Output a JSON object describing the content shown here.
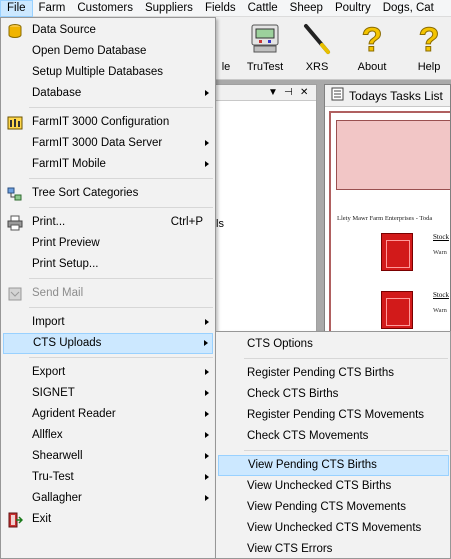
{
  "menubar": {
    "items": [
      "File",
      "Farm",
      "Customers",
      "Suppliers",
      "Fields",
      "Cattle",
      "Sheep",
      "Poultry",
      "Dogs, Cat"
    ]
  },
  "toolbar": {
    "buttons": [
      {
        "label": "le",
        "icon": "menu-icon"
      },
      {
        "label": "TruTest",
        "icon": "trutest-scale-icon"
      },
      {
        "label": "XRS",
        "icon": "xrs-wand-icon"
      },
      {
        "label": "About",
        "icon": "question-mark-icon"
      },
      {
        "label": "Help",
        "icon": "question-mark-icon"
      }
    ]
  },
  "left_panel": {
    "controls": [
      "▼",
      "⊣",
      "✕"
    ],
    "partial_text": "ls"
  },
  "tasks_window": {
    "title": "Todays Tasks List",
    "farm_line": "Llety Mawr Farm Enterprises - Toda",
    "items": [
      {
        "link": "Stock",
        "sub": "Warn"
      },
      {
        "link": "Stock",
        "sub": "Warn"
      }
    ]
  },
  "file_menu": {
    "items": [
      {
        "label": "Data Source",
        "icon": "database-icon"
      },
      {
        "label": "Open Demo Database"
      },
      {
        "label": "Setup Multiple Databases"
      },
      {
        "label": "Database",
        "submenu": true
      },
      {
        "label": "FarmIT 3000 Configuration",
        "icon": "configuration-icon"
      },
      {
        "label": "FarmIT 3000 Data Server",
        "submenu": true
      },
      {
        "label": "FarmIT Mobile",
        "submenu": true
      },
      {
        "label": "Tree Sort Categories",
        "icon": "tree-sort-icon"
      },
      {
        "label": "Print...",
        "shortcut": "Ctrl+P",
        "icon": "printer-icon"
      },
      {
        "label": "Print Preview"
      },
      {
        "label": "Print Setup..."
      },
      {
        "label": "Send Mail",
        "disabled": true,
        "icon": "send-mail-icon"
      },
      {
        "label": "Import",
        "submenu": true
      },
      {
        "label": "CTS Uploads",
        "submenu": true,
        "highlighted": true
      },
      {
        "label": "Export",
        "submenu": true
      },
      {
        "label": "SIGNET",
        "submenu": true
      },
      {
        "label": "Agrident Reader",
        "submenu": true
      },
      {
        "label": "Allflex",
        "submenu": true
      },
      {
        "label": "Shearwell",
        "submenu": true
      },
      {
        "label": "Tru-Test",
        "submenu": true
      },
      {
        "label": "Gallagher",
        "submenu": true
      },
      {
        "label": "Exit",
        "icon": "exit-icon"
      }
    ]
  },
  "cts_submenu": {
    "items": [
      {
        "label": "CTS Options"
      },
      {
        "label": "Register Pending CTS Births"
      },
      {
        "label": "Check CTS Births"
      },
      {
        "label": "Register Pending CTS Movements"
      },
      {
        "label": "Check CTS Movements"
      },
      {
        "label": "View Pending CTS Births",
        "highlighted": true
      },
      {
        "label": "View Unchecked CTS Births"
      },
      {
        "label": "View Pending CTS Movements"
      },
      {
        "label": "View Unchecked CTS Movements"
      },
      {
        "label": "View CTS Errors"
      }
    ]
  },
  "colors": {
    "highlight": "#cce8ff",
    "highlight_border": "#99d1ff",
    "menu_bg": "#f2f2f2",
    "task_pink": "#f2c6c6",
    "task_red": "#d21a1a"
  }
}
